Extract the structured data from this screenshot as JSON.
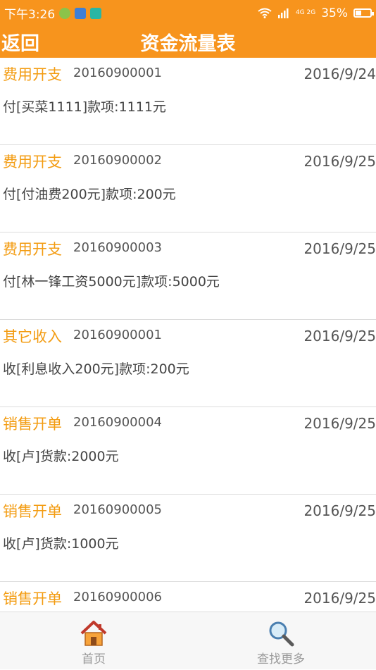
{
  "status_bar": {
    "time": "下午3:26",
    "network": "4G 2G",
    "battery": "35%",
    "battery_level": 0.35
  },
  "header": {
    "back_label": "返回",
    "title": "资金流量表"
  },
  "records": [
    {
      "category": "费用开支",
      "code": "20160900001",
      "date": "2016/9/24",
      "description": "付[买菜1111]款项:1111元"
    },
    {
      "category": "费用开支",
      "code": "20160900002",
      "date": "2016/9/25",
      "description": "付[付油费200元]款项:200元"
    },
    {
      "category": "费用开支",
      "code": "20160900003",
      "date": "2016/9/25",
      "description": "付[林一锋工资5000元]款项:5000元"
    },
    {
      "category": "其它收入",
      "code": "20160900001",
      "date": "2016/9/25",
      "description": "收[利息收入200元]款项:200元"
    },
    {
      "category": "销售开单",
      "code": "20160900004",
      "date": "2016/9/25",
      "description": "收[卢]货款:2000元"
    },
    {
      "category": "销售开单",
      "code": "20160900005",
      "date": "2016/9/25",
      "description": "收[卢]货款:1000元"
    },
    {
      "category": "销售开单",
      "code": "20160900006",
      "date": "2016/9/25",
      "description": ""
    }
  ],
  "tab_bar": {
    "home_label": "首页",
    "search_label": "查找更多",
    "home_icon": "house-icon",
    "search_icon": "magnifier-icon"
  },
  "colors": {
    "accent": "#f7941d",
    "category_text": "#f39c12"
  }
}
